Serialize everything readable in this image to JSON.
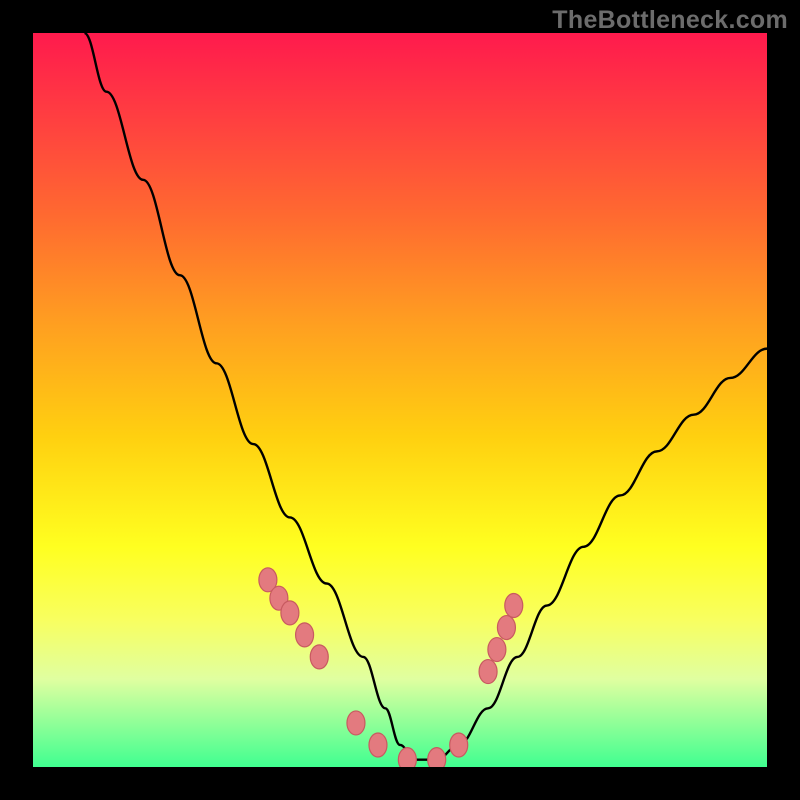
{
  "watermark": "TheBottleneck.com",
  "chart_data": {
    "type": "line",
    "title": "",
    "xlabel": "",
    "ylabel": "",
    "xlim": [
      0,
      100
    ],
    "ylim": [
      0,
      100
    ],
    "series": [
      {
        "name": "bottleneck-curve",
        "x": [
          7,
          10,
          15,
          20,
          25,
          30,
          35,
          40,
          45,
          48,
          50,
          52,
          55,
          58,
          62,
          66,
          70,
          75,
          80,
          85,
          90,
          95,
          100
        ],
        "y": [
          100,
          92,
          80,
          67,
          55,
          44,
          34,
          25,
          15,
          8,
          3,
          1,
          1,
          3,
          8,
          15,
          22,
          30,
          37,
          43,
          48,
          53,
          57
        ]
      }
    ],
    "highlight_points": {
      "name": "marker-dots",
      "x": [
        32,
        33.5,
        35,
        37,
        39,
        44,
        47,
        51,
        55,
        58,
        62,
        63.2,
        64.5,
        65.5
      ],
      "y": [
        25.5,
        23,
        21,
        18,
        15,
        6,
        3,
        1,
        1,
        3,
        13,
        16,
        19,
        22
      ]
    }
  }
}
